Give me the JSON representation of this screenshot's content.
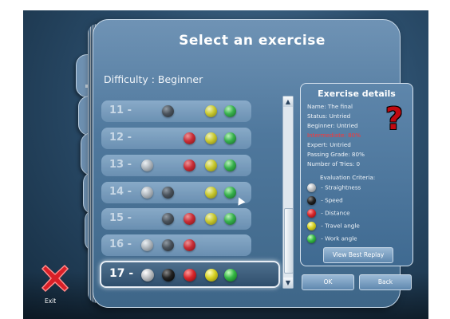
{
  "title": "Select an exercise",
  "difficulty": "Difficulty : Beginner",
  "exercises": [
    {
      "label": "11 -",
      "balls": [
        null,
        "dark",
        null,
        "yellow",
        "green"
      ]
    },
    {
      "label": "12 -",
      "balls": [
        null,
        null,
        "red",
        "yellow",
        "green"
      ]
    },
    {
      "label": "13 -",
      "balls": [
        "silver",
        null,
        "red",
        "yellow",
        "green"
      ]
    },
    {
      "label": "14 -",
      "balls": [
        "silver",
        "dark",
        null,
        "yellow",
        "green"
      ]
    },
    {
      "label": "15 -",
      "balls": [
        null,
        "dark",
        "red",
        "yellow",
        "green"
      ]
    },
    {
      "label": "16 -",
      "balls": [
        "silver",
        "dark",
        "red",
        null,
        null
      ]
    },
    {
      "label": "17 -",
      "balls": [
        "silver",
        "black",
        "red",
        "yellow",
        "green"
      ]
    }
  ],
  "scrollbar": {
    "up": "▲",
    "down": "▼"
  },
  "details": {
    "title": "Exercise details",
    "name": "Name:  The final",
    "status": "Status: Untried",
    "beginner": "Beginner: Untried",
    "intermediate": "Intermediate: 80%",
    "expert": "Expert: Untried",
    "passing": "Passing Grade: 80%",
    "tries": "Number of Tries: 0",
    "criteria": "Evaluation Criteria:",
    "legend": [
      {
        "color": "silver",
        "label": " - Straightness"
      },
      {
        "color": "black",
        "label": " - Speed"
      },
      {
        "color": "red",
        "label": " - Distance"
      },
      {
        "color": "yellow",
        "label": " - Travel angle"
      },
      {
        "color": "green",
        "label": " - Work angle"
      }
    ],
    "replay": "View Best Replay"
  },
  "buttons": {
    "ok": "OK",
    "back": "Back"
  },
  "exit": "Exit",
  "colors": {
    "accent": "#4f789d",
    "red": "#d7262b"
  }
}
